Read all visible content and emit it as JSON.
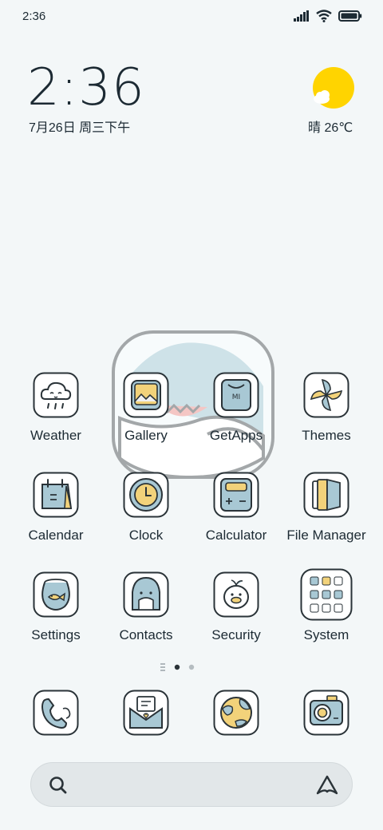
{
  "status_bar": {
    "time": "2:36",
    "icons": [
      "signal-icon",
      "wifi-icon",
      "battery-icon"
    ]
  },
  "clock_widget": {
    "time": "2:36",
    "date": "7月26日 周三下午"
  },
  "weather_widget": {
    "text": "晴 26℃",
    "icon": "sun-cloud-icon"
  },
  "apps": [
    {
      "label": "Weather",
      "icon": "weather-icon"
    },
    {
      "label": "Gallery",
      "icon": "gallery-icon"
    },
    {
      "label": "GetApps",
      "icon": "getapps-icon"
    },
    {
      "label": "Themes",
      "icon": "themes-icon"
    },
    {
      "label": "Calendar",
      "icon": "calendar-icon"
    },
    {
      "label": "Clock",
      "icon": "clock-icon"
    },
    {
      "label": "Calculator",
      "icon": "calculator-icon"
    },
    {
      "label": "File Manager",
      "icon": "file-manager-icon"
    },
    {
      "label": "Settings",
      "icon": "settings-icon"
    },
    {
      "label": "Contacts",
      "icon": "contacts-icon"
    },
    {
      "label": "Security",
      "icon": "security-icon"
    },
    {
      "label": "System",
      "icon": "system-folder-icon"
    }
  ],
  "dock": [
    {
      "icon": "phone-icon"
    },
    {
      "icon": "messages-icon"
    },
    {
      "icon": "browser-icon"
    },
    {
      "icon": "camera-icon"
    }
  ],
  "page_indicator": {
    "pages": 2,
    "current": 1
  },
  "colors": {
    "background": "#f3f7f8",
    "icon_blue": "#a8c8d4",
    "icon_yellow": "#f2d27a",
    "outline": "#2a3338",
    "sun": "#ffd400"
  }
}
